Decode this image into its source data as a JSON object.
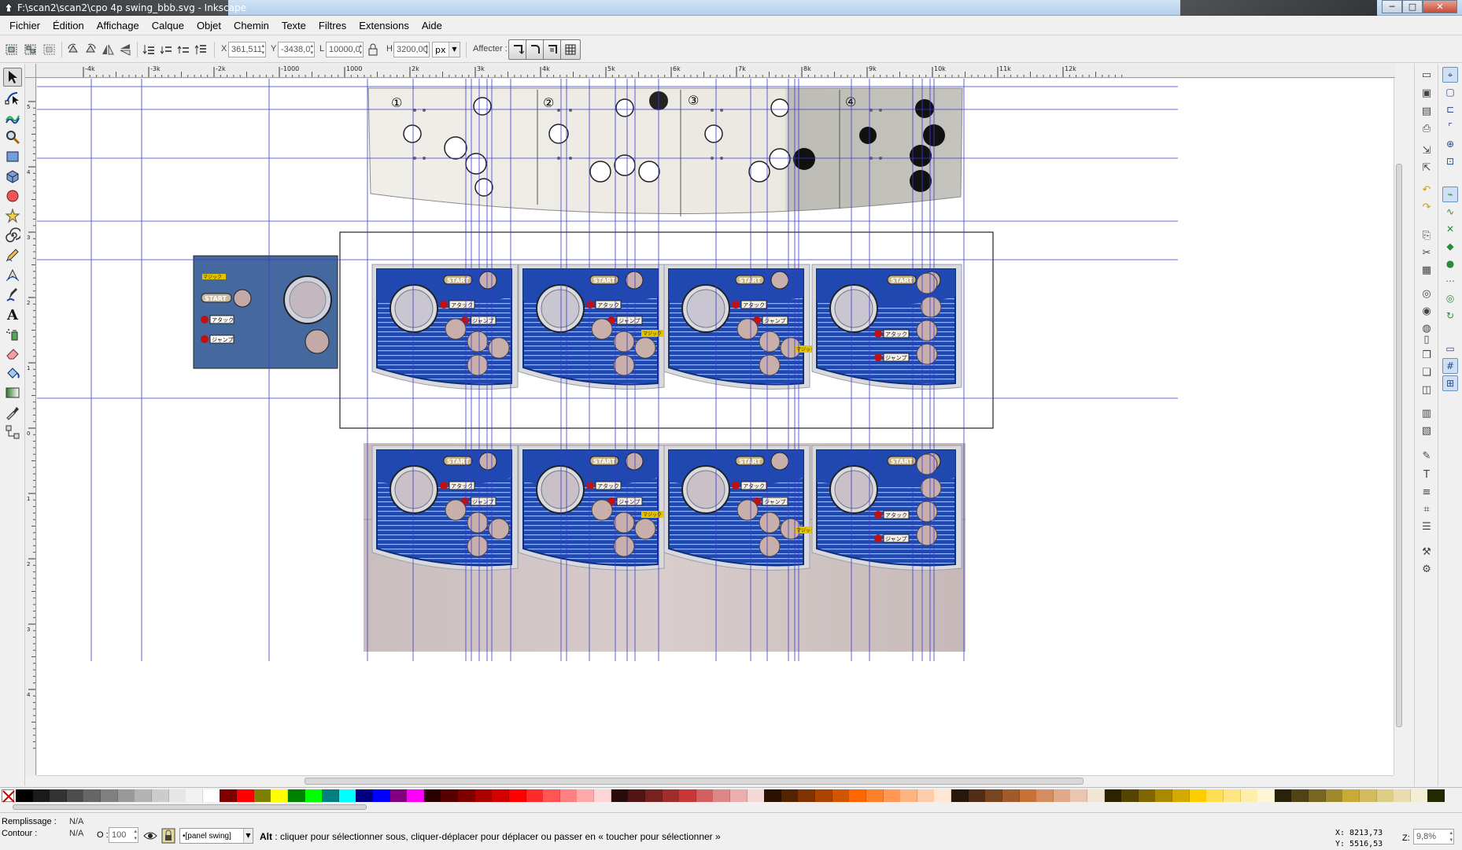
{
  "window": {
    "title": "F:\\scan2\\scan2\\cpo 4p swing_bbb.svg - Inkscape",
    "minimize": "─",
    "maximize": "□",
    "close": "✕"
  },
  "menu": [
    "Fichier",
    "Édition",
    "Affichage",
    "Calque",
    "Objet",
    "Chemin",
    "Texte",
    "Filtres",
    "Extensions",
    "Aide"
  ],
  "controls": {
    "x_label": "X",
    "x_value": "361,511",
    "y_label": "Y",
    "y_value": "-3438,0",
    "w_label": "L",
    "w_value": "10000,0",
    "h_label": "H",
    "h_value": "3200,00",
    "unit": "px",
    "affect_label": "Affecter :"
  },
  "ruler_top_labels": [
    "-4k",
    "-3k",
    "-2k",
    "-1000",
    "1000",
    "2k",
    "3k",
    "4k",
    "5k",
    "6k",
    "7k",
    "8k",
    "9k",
    "10k",
    "11k",
    "12k"
  ],
  "ruler_left_labels": [
    "5",
    "4",
    "3",
    "2",
    "1",
    "0",
    "1",
    "2",
    "3",
    "4"
  ],
  "artwork": {
    "side_panel_texts": [
      "マジック",
      "START",
      "アタック",
      "ジャンプ"
    ],
    "panel_texts": {
      "start": "START",
      "attack": "アタック",
      "jump": "ジャンプ",
      "magic": "マジック"
    },
    "scan_numbers": [
      "①",
      "②",
      "③",
      "④"
    ]
  },
  "palette_colors": [
    "#000000",
    "#1a1a1a",
    "#333333",
    "#4d4d4d",
    "#666666",
    "#808080",
    "#999999",
    "#b3b3b3",
    "#cccccc",
    "#e6e6e6",
    "#f2f2f2",
    "#ffffff",
    "#800000",
    "#ff0000",
    "#808000",
    "#ffff00",
    "#008000",
    "#00ff00",
    "#008080",
    "#00ffff",
    "#000080",
    "#0000ff",
    "#800080",
    "#ff00ff",
    "#2b0000",
    "#550000",
    "#800000",
    "#aa0000",
    "#d40000",
    "#ff0000",
    "#ff2a2a",
    "#ff5555",
    "#ff8080",
    "#ffaaaa",
    "#ffd5d5",
    "#280b0b",
    "#501616",
    "#782121",
    "#a02c2c",
    "#c83737",
    "#d35f5f",
    "#de8787",
    "#e9afaf",
    "#f4d7d7",
    "#2b1100",
    "#552200",
    "#803300",
    "#aa4400",
    "#d45500",
    "#ff6600",
    "#ff7f2a",
    "#ff9955",
    "#ffb380",
    "#ffccaa",
    "#ffe6d5",
    "#28170b",
    "#502d16",
    "#784421",
    "#a05a2c",
    "#c87137",
    "#d38d5f",
    "#deaa87",
    "#e9c6af",
    "#f4e3d7",
    "#2b2200",
    "#554400",
    "#806600",
    "#aa8800",
    "#d4aa00",
    "#ffcc00",
    "#ffdd55",
    "#ffe680",
    "#ffeeaa",
    "#fff6d5",
    "#28220b",
    "#504416",
    "#786721",
    "#a0892c",
    "#c8ab37",
    "#d3bc5f",
    "#decd87",
    "#e9ddaf",
    "#f4eed7",
    "#222b00"
  ],
  "status": {
    "fill_label": "Remplissage :",
    "fill_value": "N/A",
    "stroke_label": "Contour :",
    "stroke_value": "N/A",
    "opacity_label": "O :",
    "opacity_value": "100",
    "layer": "•[panel swing]",
    "message_bold": "Alt",
    "message": " : cliquer pour sélectionner sous, cliquer-déplacer pour déplacer ou passer en « toucher pour sélectionner »",
    "x_coord": "X: 8213,73",
    "y_coord": "Y: 5516,53",
    "zoom_label": "Z:",
    "zoom_value": "9,8%"
  }
}
